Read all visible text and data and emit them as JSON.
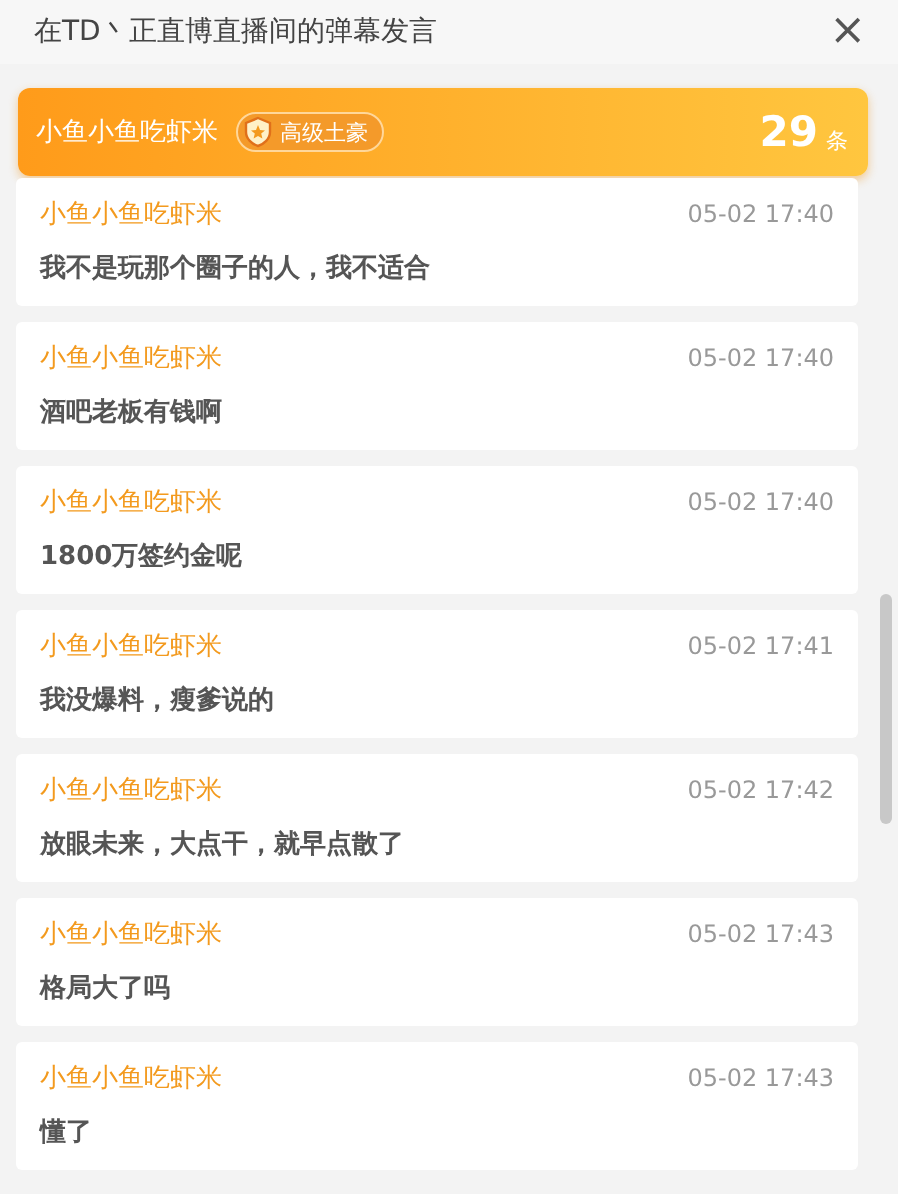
{
  "header": {
    "title": "在TD丶正直博直播间的弹幕发言",
    "close": "×"
  },
  "banner": {
    "user": "小鱼小鱼吃虾米",
    "badge": "高级土豪",
    "count": "29",
    "unit": "条"
  },
  "messages": [
    {
      "user": "小鱼小鱼吃虾米",
      "time": "05-02 17:40",
      "text": "我不是玩那个圈子的人，我不适合"
    },
    {
      "user": "小鱼小鱼吃虾米",
      "time": "05-02 17:40",
      "text": "酒吧老板有钱啊"
    },
    {
      "user": "小鱼小鱼吃虾米",
      "time": "05-02 17:40",
      "text": "1800万签约金呢"
    },
    {
      "user": "小鱼小鱼吃虾米",
      "time": "05-02 17:41",
      "text": "我没爆料，瘦爹说的"
    },
    {
      "user": "小鱼小鱼吃虾米",
      "time": "05-02 17:42",
      "text": "放眼未来，大点干，就早点散了"
    },
    {
      "user": "小鱼小鱼吃虾米",
      "time": "05-02 17:43",
      "text": "格局大了吗"
    },
    {
      "user": "小鱼小鱼吃虾米",
      "time": "05-02 17:43",
      "text": "懂了"
    }
  ]
}
